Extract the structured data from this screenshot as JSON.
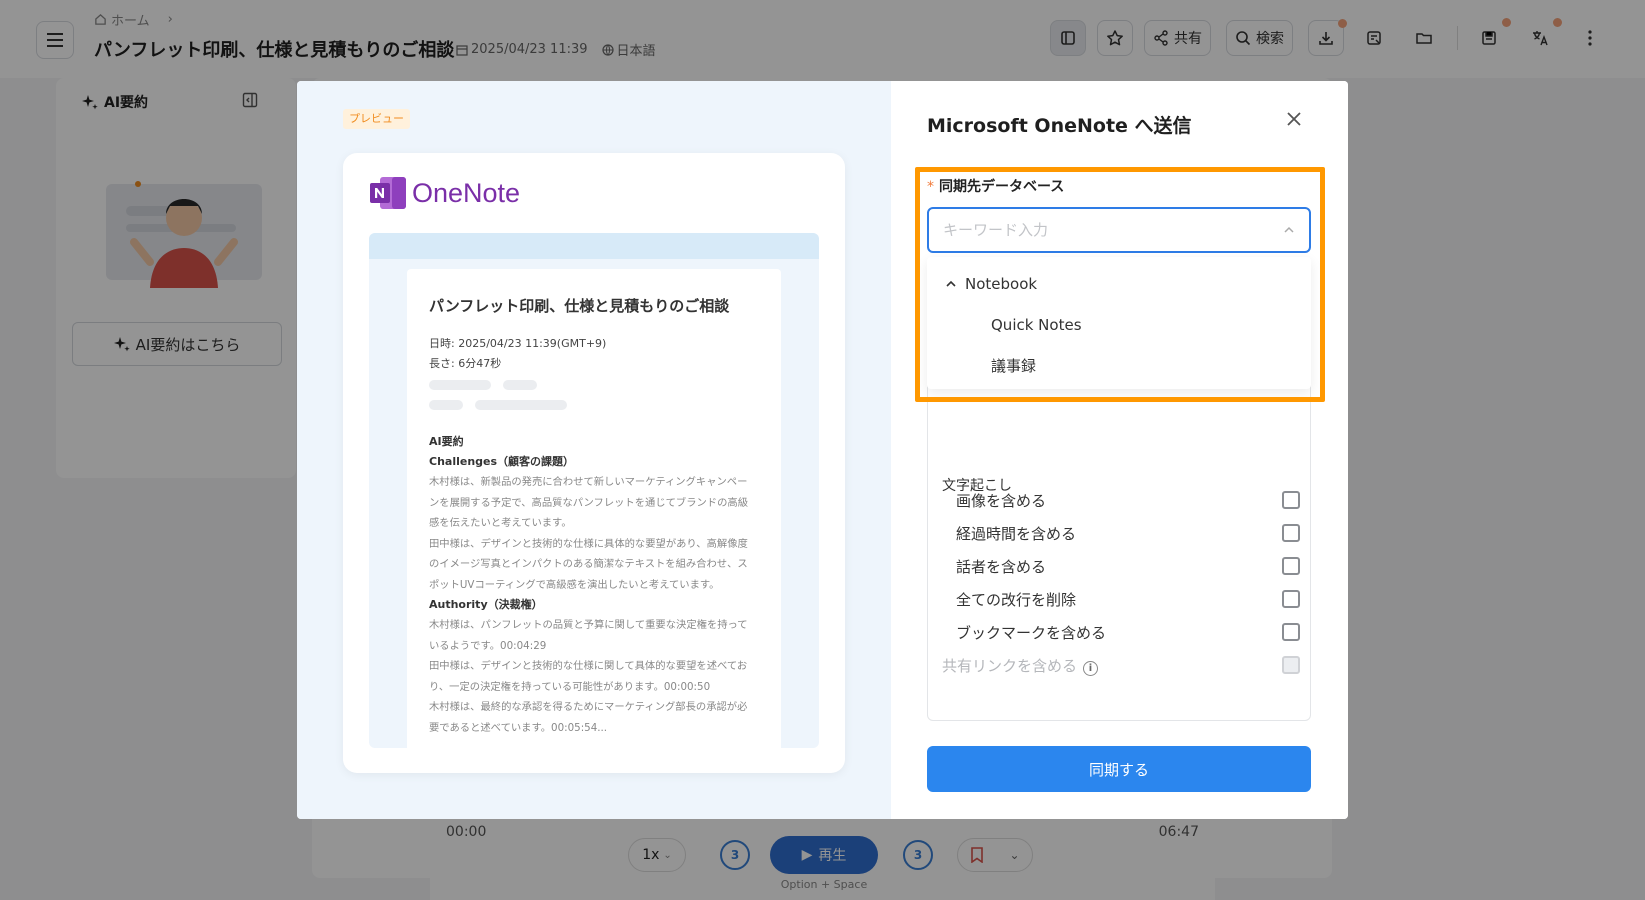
{
  "app": {
    "breadcrumb": {
      "home_label": "ホーム"
    },
    "document": {
      "title": "パンフレット印刷、仕様と見積もりのご相談",
      "date": "2025/04/23 11:39",
      "language": "日本語"
    },
    "toolbar": {
      "share_label": "共有",
      "search_label": "検索",
      "notification_dot_color": "#f4a27a"
    },
    "left_panel": {
      "title": "AI要約",
      "cta_label": "AI要約はこちら"
    },
    "player": {
      "current_time": "00:00",
      "total_time": "06:47",
      "speed": "1x",
      "skip_seconds": "3",
      "play_label": "再生",
      "shortcut_hint": "Option + Space"
    }
  },
  "modal": {
    "preview": {
      "tag": "プレビュー",
      "logo_text": "OneNote",
      "doc_title": "パンフレット印刷、仕様と見積もりのご相談",
      "date_line": "日時: 2025/04/23 11:39(GMT+9)",
      "length_line": "長さ: 6分47秒",
      "summary_heading": "AI要約",
      "sections": [
        {
          "heading": "Challenges（顧客の課題）",
          "lines": [
            "木村様は、新製品の発売に合わせて新しいマーケティングキャンペー",
            "ンを展開する予定で、高品質なパンフレットを通じてブランドの高級",
            "感を伝えたいと考えています。",
            "田中様は、デザインと技術的な仕様に具体的な要望があり、高解像度",
            "のイメージ写真とインパクトのある簡潔なテキストを組み合わせ、ス",
            "ポットUVコーティングで高級感を演出したいと考えています。"
          ]
        },
        {
          "heading": "Authority（決裁権）",
          "lines": [
            "木村様は、パンフレットの品質と予算に関して重要な決定権を持って",
            "いるようです。00:04:29",
            "田中様は、デザインと技術的な仕様に関して具体的な要望を述べてお",
            "り、一定の決定権を持っている可能性があります。00:00:50",
            "木村様は、最終的な承認を得るためにマーケティング部長の承認が必",
            "要であると述べています。00:05:54..."
          ]
        }
      ]
    },
    "form": {
      "title": "Microsoft OneNote へ送信",
      "required_mark": "*",
      "db_label": "同期先データベース",
      "db_placeholder": "キーワード入力",
      "dropdown": {
        "group": "Notebook",
        "items": [
          "Quick Notes",
          "議事録"
        ]
      },
      "options_section": "文字起こし",
      "options": [
        {
          "label": "画像を含める",
          "checked": false
        },
        {
          "label": "経過時間を含める",
          "checked": false
        },
        {
          "label": "話者を含める",
          "checked": false
        },
        {
          "label": "全ての改行を削除",
          "checked": false
        },
        {
          "label": "ブックマークを含める",
          "checked": false
        }
      ],
      "disabled_option": {
        "label": "共有リンクを含める",
        "info": "i"
      },
      "submit_label": "同期する"
    },
    "colors": {
      "accent": "#2b86ee",
      "highlight": "#ff9800",
      "onenote_purple": "#7a2fa8"
    }
  }
}
